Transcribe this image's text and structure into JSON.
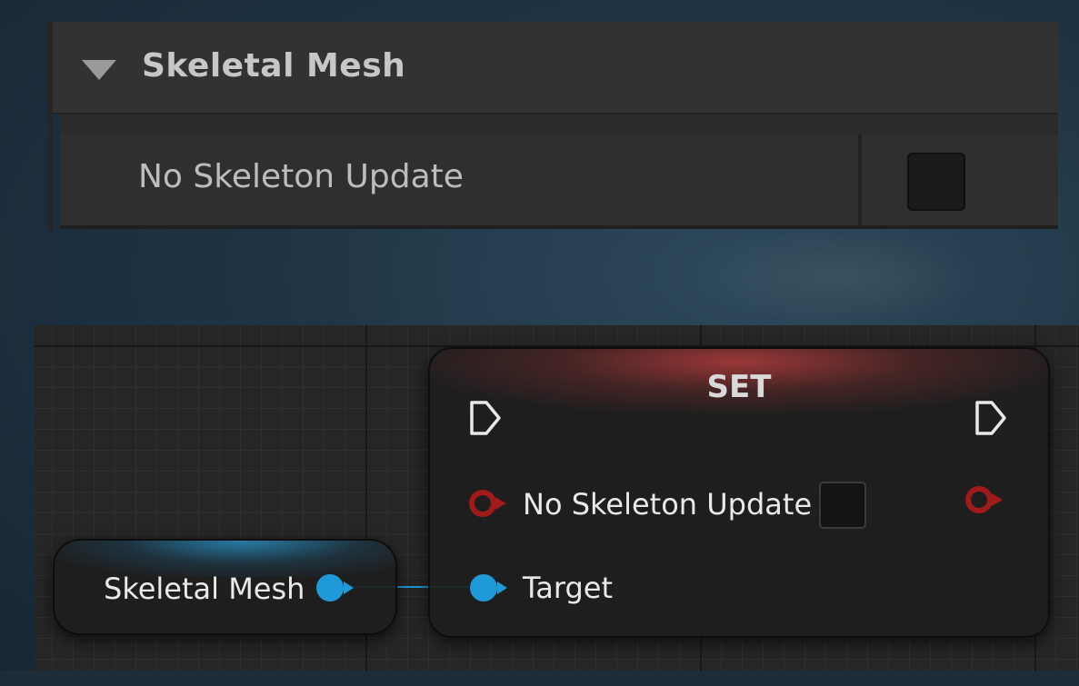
{
  "details_panel": {
    "category_title": "Skeletal Mesh",
    "property_name": "No Skeleton Update",
    "property_checked": false
  },
  "set_node": {
    "title": "SET",
    "pin_label": "No Skeleton Update",
    "pin_checked": false,
    "target_label": "Target",
    "header_color": "#a83a3a",
    "bool_pin_color": "#a01a1a"
  },
  "get_node": {
    "label": "Skeletal Mesh",
    "header_color": "#288cbe",
    "object_pin_color": "#1e9ad8"
  },
  "icons": [
    "triangle-down-icon",
    "exec-pin-icon",
    "bool-pin-icon",
    "object-pin-icon"
  ]
}
